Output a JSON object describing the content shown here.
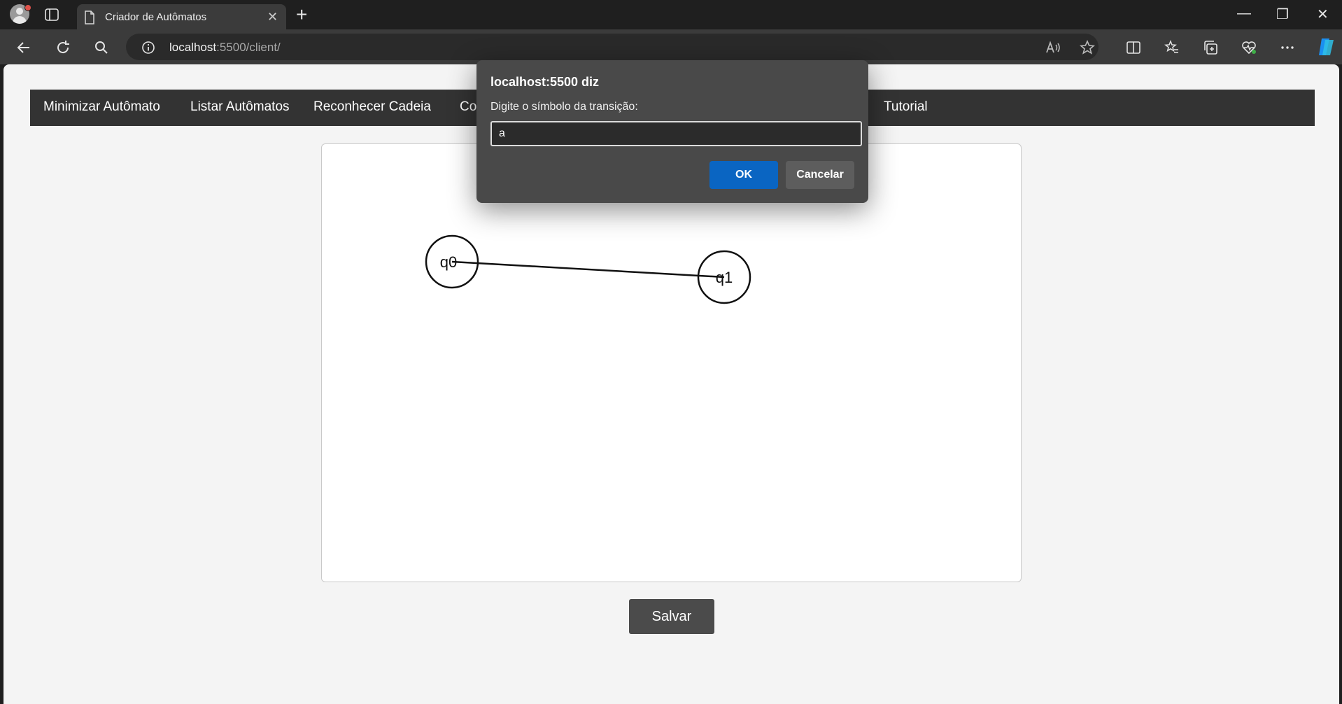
{
  "browser": {
    "tab_title": "Criador de Autômatos",
    "tab_close": "✕",
    "new_tab": "+",
    "url_host": "localhost",
    "url_rest": ":5500/client/",
    "window_controls": {
      "minimize": "—",
      "restore": "❐",
      "close": "✕"
    },
    "icons": [
      "profile-avatar-icon",
      "tab-actions-icon",
      "page-icon",
      "back-icon",
      "refresh-icon",
      "search-icon",
      "info-icon",
      "read-aloud-icon",
      "favorite-star-icon",
      "split-screen-icon",
      "favorites-icon",
      "collections-icon",
      "browser-essentials-icon",
      "more-icon",
      "copilot-icon"
    ]
  },
  "nav": {
    "items": [
      "Minimizar Autômato",
      "Listar Autômatos",
      "Reconhecer Cadeia",
      "Cor",
      "Tutorial"
    ]
  },
  "automaton": {
    "states": [
      "q0",
      "q1"
    ],
    "transitions": [
      {
        "from": "q0",
        "to": "q1"
      }
    ]
  },
  "save_label": "Salvar",
  "dialog": {
    "title": "localhost:5500 diz",
    "message": "Digite o símbolo da transição:",
    "input_value": "a",
    "ok_label": "OK",
    "cancel_label": "Cancelar"
  },
  "colors": {
    "chrome": "#1f1f1f",
    "toolbar": "#3b3b3b",
    "navbar": "#333333",
    "ok_button": "#0a65c2",
    "dialog_bg": "#494949"
  }
}
